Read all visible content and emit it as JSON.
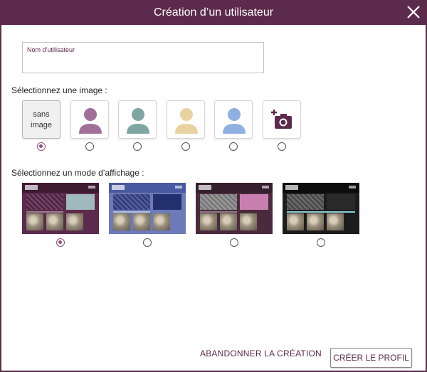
{
  "dialog": {
    "title": "Création d’un utilisateur",
    "close_icon": "close-icon"
  },
  "username": {
    "label": "Nom d’utilisateur",
    "value": ""
  },
  "image_section": {
    "label": "Sélectionnez une image :",
    "options": [
      {
        "name": "sans image",
        "label_line1": "sans",
        "label_line2": "image",
        "selected": true
      },
      {
        "name": "avatar-purple",
        "color": "#a0709a",
        "selected": false
      },
      {
        "name": "avatar-teal",
        "color": "#7fa6a2",
        "selected": false
      },
      {
        "name": "avatar-beige",
        "color": "#e8d2a0",
        "selected": false
      },
      {
        "name": "avatar-blue",
        "color": "#8fb0e0",
        "selected": false
      },
      {
        "name": "camera",
        "icon": "add-photo-icon",
        "color": "#5c2a4c",
        "selected": false
      }
    ]
  },
  "display_section": {
    "label": "Sélectionnez un mode d’affichage :",
    "themes": [
      {
        "name": "aubergine",
        "bg": "#5c2a4c",
        "header": "#3e1a33",
        "side": "#9fb9bd",
        "selected": true
      },
      {
        "name": "blue",
        "bg": "#6d7ab8",
        "header": "#4a5aa0",
        "side": "#23306f",
        "selected": false
      },
      {
        "name": "rose",
        "bg": "#4a2a3c",
        "header": "#36202d",
        "side": "#c87fb0",
        "selected": false
      },
      {
        "name": "dark",
        "bg": "#1c1c1c",
        "header": "#0c0c0c",
        "side": "#8fd0d8",
        "selected": false
      }
    ]
  },
  "actions": {
    "cancel_label": "ABANDONNER LA CRÉATION",
    "create_label": "CRÉER LE PROFIL"
  },
  "colors": {
    "accent": "#5c2a4c",
    "radio_selected": "#8f4d7f"
  }
}
